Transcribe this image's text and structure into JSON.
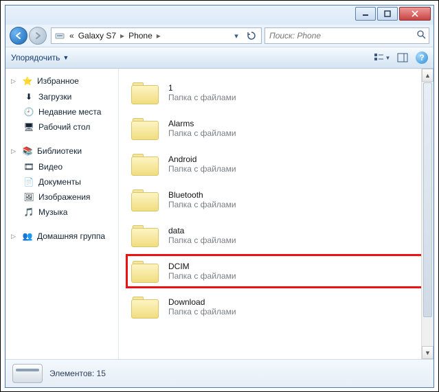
{
  "breadcrumb": {
    "prefix": "«",
    "items": [
      "Galaxy S7",
      "Phone"
    ]
  },
  "search": {
    "placeholder": "Поиск: Phone"
  },
  "toolbar": {
    "organize_label": "Упорядочить"
  },
  "sidebar": {
    "favorites": {
      "title": "Избранное",
      "items": [
        {
          "icon": "downloads-icon",
          "glyph": "⬇",
          "label": "Загрузки"
        },
        {
          "icon": "recent-icon",
          "glyph": "🕘",
          "label": "Недавние места"
        },
        {
          "icon": "desktop-icon",
          "glyph": "🖥",
          "label": "Рабочий стол"
        }
      ]
    },
    "libraries": {
      "title": "Библиотеки",
      "items": [
        {
          "icon": "video-icon",
          "glyph": "🎞",
          "label": "Видео"
        },
        {
          "icon": "documents-icon",
          "glyph": "📄",
          "label": "Документы"
        },
        {
          "icon": "pictures-icon",
          "glyph": "🖼",
          "label": "Изображения"
        },
        {
          "icon": "music-icon",
          "glyph": "🎵",
          "label": "Музыка"
        }
      ]
    },
    "homegroup": {
      "title": "Домашняя группа"
    }
  },
  "content": {
    "sub_label": "Папка с файлами",
    "folders": [
      {
        "name": "1",
        "highlight": false
      },
      {
        "name": "Alarms",
        "highlight": false
      },
      {
        "name": "Android",
        "highlight": false
      },
      {
        "name": "Bluetooth",
        "highlight": false
      },
      {
        "name": "data",
        "highlight": false
      },
      {
        "name": "DCIM",
        "highlight": true
      },
      {
        "name": "Download",
        "highlight": false
      }
    ]
  },
  "status": {
    "label": "Элементов: 15"
  }
}
